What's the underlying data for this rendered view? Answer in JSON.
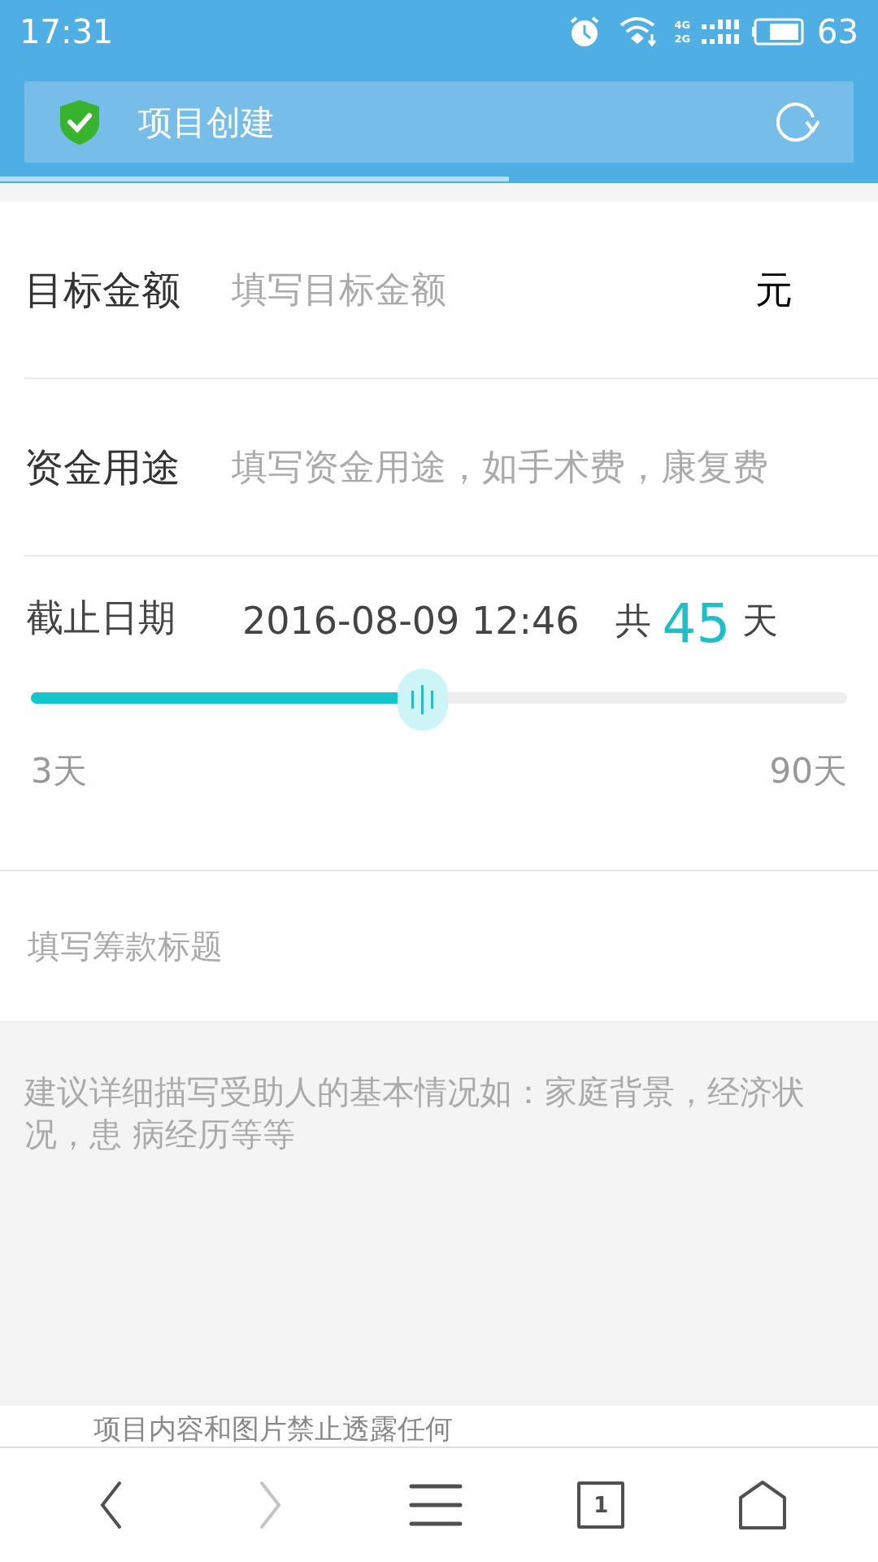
{
  "status_bar": {
    "time": "17:31",
    "network_top": "4G",
    "network_bottom": "2G",
    "battery": "63"
  },
  "address_bar": {
    "title": "项目创建",
    "secure": true
  },
  "page_load": {
    "level": 0.58
  },
  "fields": [
    {
      "kind": "text",
      "label": "目标金额",
      "placeholder": "填写目标金额",
      "unit": "元"
    },
    {
      "kind": "text",
      "label": "资金用途",
      "placeholder": "填写资金用途，如手术费，康复费"
    }
  ],
  "deadline": {
    "label": "截止日期",
    "date": "2016-08-09 12:46",
    "total_prefix": "共",
    "days": "45",
    "total_suffix": "天",
    "slider": {
      "level": 0.48
    },
    "min_label": "3天",
    "max_label": "90天"
  },
  "title_field": {
    "placeholder": "填写筹款标题"
  },
  "description_field": {
    "placeholder": "建议详细描写受助人的基本情况如：家庭背景，经济状况，患 病经历等等"
  },
  "notice": "项目内容和图片禁止透露任何",
  "nav": [
    {
      "kind": "back",
      "disabled": false
    },
    {
      "kind": "forward",
      "disabled": true
    },
    {
      "kind": "menu",
      "disabled": false
    },
    {
      "kind": "tabs",
      "disabled": false,
      "count": "1"
    },
    {
      "kind": "home",
      "disabled": false
    }
  ]
}
